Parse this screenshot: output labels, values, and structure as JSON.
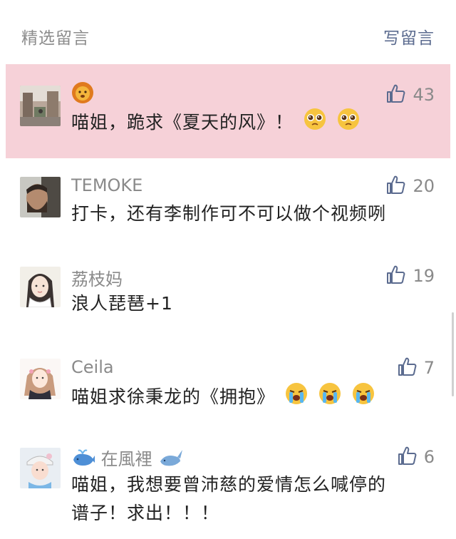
{
  "header": {
    "title": "精选留言",
    "write_label": "写留言"
  },
  "comments": [
    {
      "nickname": "",
      "nickname_icon": "lion-face-emoji",
      "likes": "43",
      "text": "喵姐，跪求《夏天的风》！",
      "trailing_emojis": [
        "pleading-face-emoji",
        "pleading-face-emoji"
      ],
      "highlighted": true
    },
    {
      "nickname": "TEMOKE",
      "likes": "20",
      "text": "打卡，还有李制作可不可以做个视频咧"
    },
    {
      "nickname": "荔枝妈",
      "likes": "19",
      "text": "浪人琵琶+1"
    },
    {
      "nickname": "Ceila",
      "likes": "7",
      "text": "喵姐求徐秉龙的《拥抱》",
      "trailing_emojis": [
        "loudly-crying-face-emoji",
        "loudly-crying-face-emoji",
        "loudly-crying-face-emoji"
      ]
    },
    {
      "nickname": "在風裡",
      "nickname_icons": [
        "spouting-whale-emoji",
        "whale-emoji"
      ],
      "likes": "6",
      "text_line1": "喵姐，我想要曾沛慈的爱情怎么喊停的",
      "text_line2": "谱子！求出！！！"
    }
  ],
  "colors": {
    "highlight_bg": "#f6d1d8",
    "link": "#5b6b8f",
    "meta": "#8a8a8a",
    "text": "#222222"
  }
}
